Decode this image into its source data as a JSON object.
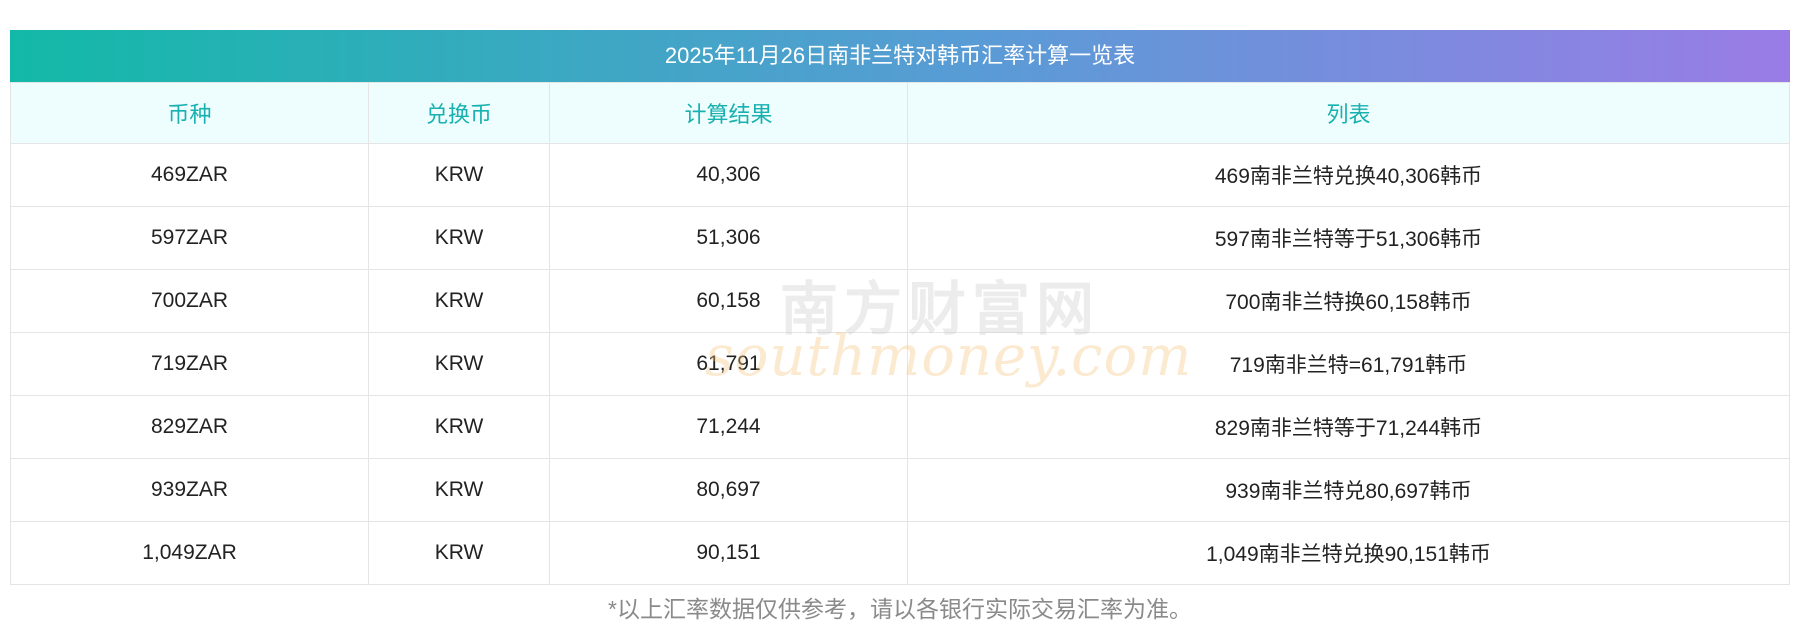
{
  "title": "2025年11月26日南非兰特对韩币汇率计算一览表",
  "headers": [
    "币种",
    "兑换币",
    "计算结果",
    "列表"
  ],
  "rows": [
    {
      "currency": "469ZAR",
      "target": "KRW",
      "result": "40,306",
      "desc": "469南非兰特兑换40,306韩币"
    },
    {
      "currency": "597ZAR",
      "target": "KRW",
      "result": "51,306",
      "desc": "597南非兰特等于51,306韩币"
    },
    {
      "currency": "700ZAR",
      "target": "KRW",
      "result": "60,158",
      "desc": "700南非兰特换60,158韩币"
    },
    {
      "currency": "719ZAR",
      "target": "KRW",
      "result": "61,791",
      "desc": "719南非兰特=61,791韩币"
    },
    {
      "currency": "829ZAR",
      "target": "KRW",
      "result": "71,244",
      "desc": "829南非兰特等于71,244韩币"
    },
    {
      "currency": "939ZAR",
      "target": "KRW",
      "result": "80,697",
      "desc": "939南非兰特兑80,697韩币"
    },
    {
      "currency": "1,049ZAR",
      "target": "KRW",
      "result": "90,151",
      "desc": "1,049南非兰特兑换90,151韩币"
    }
  ],
  "footnote": "*以上汇率数据仅供参考，请以各银行实际交易汇率为准。",
  "watermark": {
    "cn": "南方财富网",
    "en": "southmoney.com"
  },
  "colors": {
    "header_text": "#19b0b0",
    "gradient_start": "#13b9a8",
    "gradient_end": "#9a7ce6"
  }
}
